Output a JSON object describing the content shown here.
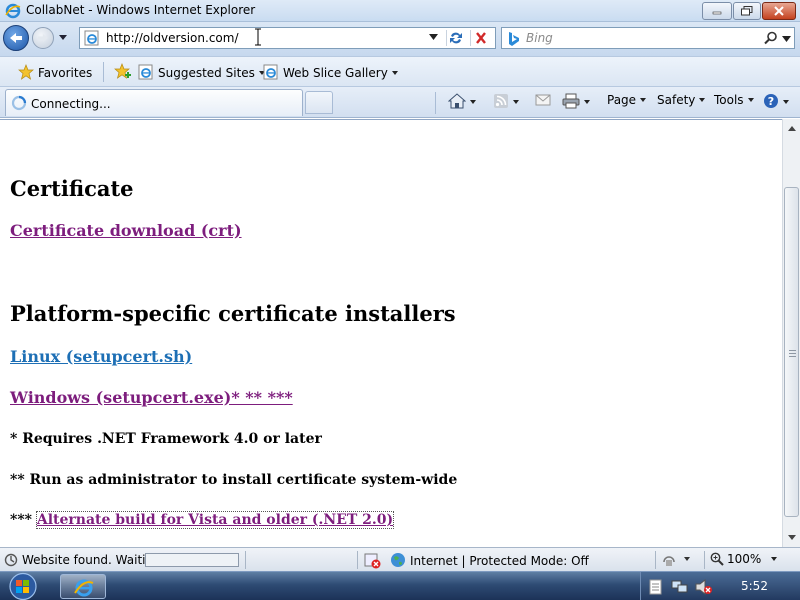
{
  "window": {
    "title": "CollabNet - Windows Internet Explorer"
  },
  "address_bar": {
    "url": "http://oldversion.com/"
  },
  "search": {
    "placeholder": "Bing"
  },
  "favorites_bar": {
    "favorites_label": "Favorites",
    "items": [
      {
        "label": "Suggested Sites"
      },
      {
        "label": "Web Slice Gallery"
      }
    ]
  },
  "tab": {
    "label": "Connecting..."
  },
  "command_bar": {
    "page_label": "Page",
    "safety_label": "Safety",
    "tools_label": "Tools"
  },
  "page": {
    "heading_certificate": "Certificate",
    "link_certificate_download": "Certificate download (crt)",
    "heading_installers": "Platform-specific certificate installers",
    "link_linux": "Linux (setupcert.sh)",
    "link_windows": "Windows (setupcert.exe)* ** ***",
    "note_1": "* Requires .NET Framework 4.0 or later",
    "note_2": "** Run as administrator to install certificate system-wide",
    "note_3_prefix": "***",
    "link_alternate": "Alternate build for Vista and older (.NET 2.0)"
  },
  "status_bar": {
    "status_text": "Website found. Waitin",
    "progress_fraction": 0.0,
    "zone_text": "Internet | Protected Mode: Off",
    "zoom_text": "100%"
  },
  "taskbar": {
    "clock": "5:52"
  },
  "colors": {
    "visited_link": "#7d1d7d",
    "unvisited_link": "#1d6fb5",
    "chrome_blue": "#c9dcf1"
  }
}
